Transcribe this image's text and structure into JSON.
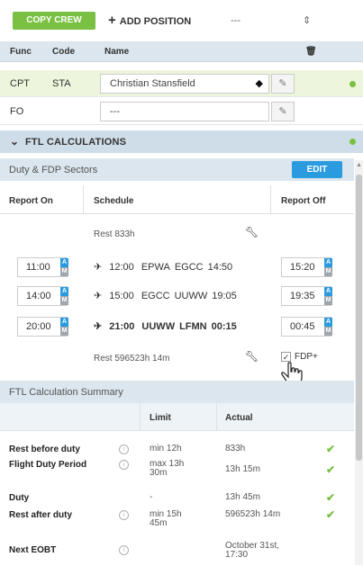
{
  "toolbar": {
    "copy_crew": "COPY CREW",
    "add_position": "ADD POSITION",
    "position_select": "---"
  },
  "crew_table": {
    "headers": {
      "func": "Func",
      "code": "Code",
      "name": "Name"
    },
    "rows": [
      {
        "func": "CPT",
        "code": "STA",
        "name": "Christian Stansfield",
        "highlight": true
      },
      {
        "func": "FO",
        "code": "",
        "name": "---",
        "highlight": false
      }
    ]
  },
  "ftl": {
    "section_title": "FTL CALCULATIONS",
    "sectors_title": "Duty & FDP Sectors",
    "edit_label": "EDIT",
    "headers": {
      "report_on": "Report On",
      "schedule": "Schedule",
      "report_off": "Report Off"
    },
    "rest_before": "Rest 833h",
    "sectors": [
      {
        "report_on": "11:00",
        "dep_time": "12:00",
        "from": "EPWA",
        "to": "EGCC",
        "arr_time": "14:50",
        "report_off": "15:20",
        "bold": false
      },
      {
        "report_on": "14:00",
        "dep_time": "15:00",
        "from": "EGCC",
        "to": "UUWW",
        "arr_time": "19:05",
        "report_off": "19:35",
        "bold": false
      },
      {
        "report_on": "20:00",
        "dep_time": "21:00",
        "from": "UUWW",
        "to": "LFMN",
        "arr_time": "00:15",
        "report_off": "00:45",
        "bold": true
      }
    ],
    "rest_after": "Rest 596523h 14m",
    "fdp_plus_label": "FDP+",
    "fdp_plus_checked": true
  },
  "summary": {
    "title": "FTL Calculation Summary",
    "headers": {
      "limit": "Limit",
      "actual": "Actual"
    },
    "rows": [
      {
        "label": "Rest before duty",
        "limit": "min 12h",
        "actual": "833h",
        "ok": true
      },
      {
        "label": "Flight Duty Period",
        "limit": "max 13h 30m",
        "actual": "13h 15m",
        "ok": true
      },
      {
        "label": "Duty",
        "limit": "-",
        "actual": "13h 45m",
        "ok": true
      },
      {
        "label": "Rest after duty",
        "limit": "min 15h 45m",
        "actual": "596523h 14m",
        "ok": true
      },
      {
        "label": "Next EOBT",
        "limit": "",
        "actual": "October 31st, 17:30",
        "ok": false
      }
    ]
  },
  "colors": {
    "green": "#7ac143",
    "blue": "#2b9be0",
    "header_bg": "#dbe6ee"
  }
}
